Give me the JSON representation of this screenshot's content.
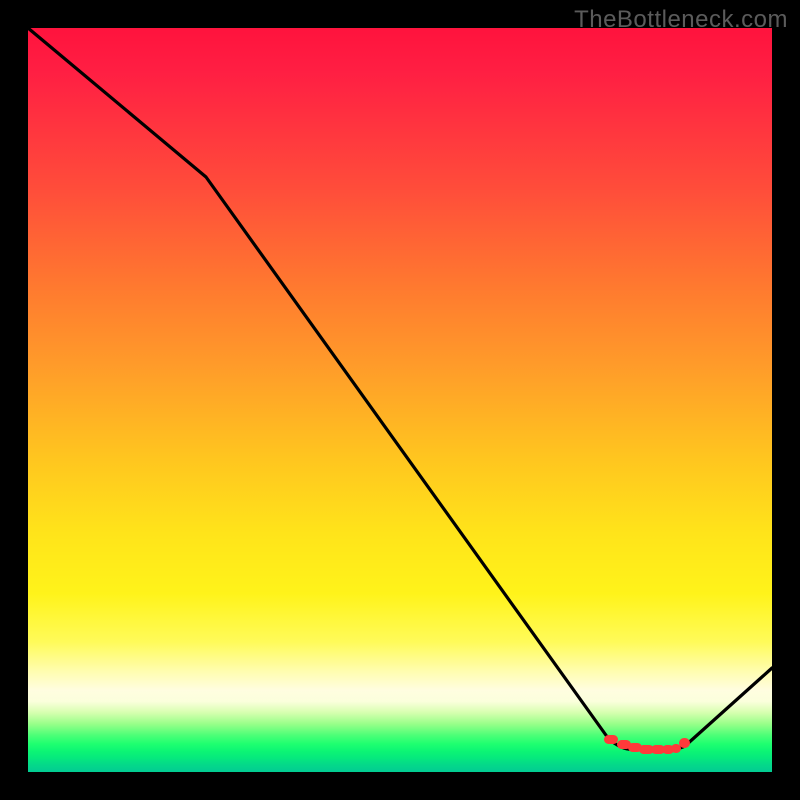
{
  "watermark": "TheBottleneck.com",
  "chart_data": {
    "type": "line",
    "title": "",
    "xlabel": "",
    "ylabel": "",
    "ylim": [
      0,
      100
    ],
    "xlim": [
      0,
      100
    ],
    "series": [
      {
        "name": "curve",
        "x": [
          0,
          24,
          78,
          82,
          86,
          100
        ],
        "values": [
          100,
          80,
          4.5,
          3,
          3,
          14
        ]
      }
    ],
    "markers": {
      "x": [
        78,
        79.5,
        81,
        82.5,
        84,
        85.5,
        86,
        88
      ],
      "values": [
        4,
        3.5,
        3.2,
        3.0,
        3.0,
        3.0,
        3.1,
        3.8
      ],
      "color": "#ff3a3a",
      "shape": "rounded-rect"
    },
    "gradient_stops": [
      {
        "pos": 0.0,
        "color": "#ff133d"
      },
      {
        "pos": 0.45,
        "color": "#ff9a2a"
      },
      {
        "pos": 0.76,
        "color": "#fff31a"
      },
      {
        "pos": 0.9,
        "color": "#fbffdc"
      },
      {
        "pos": 1.0,
        "color": "#02cc93"
      }
    ]
  }
}
